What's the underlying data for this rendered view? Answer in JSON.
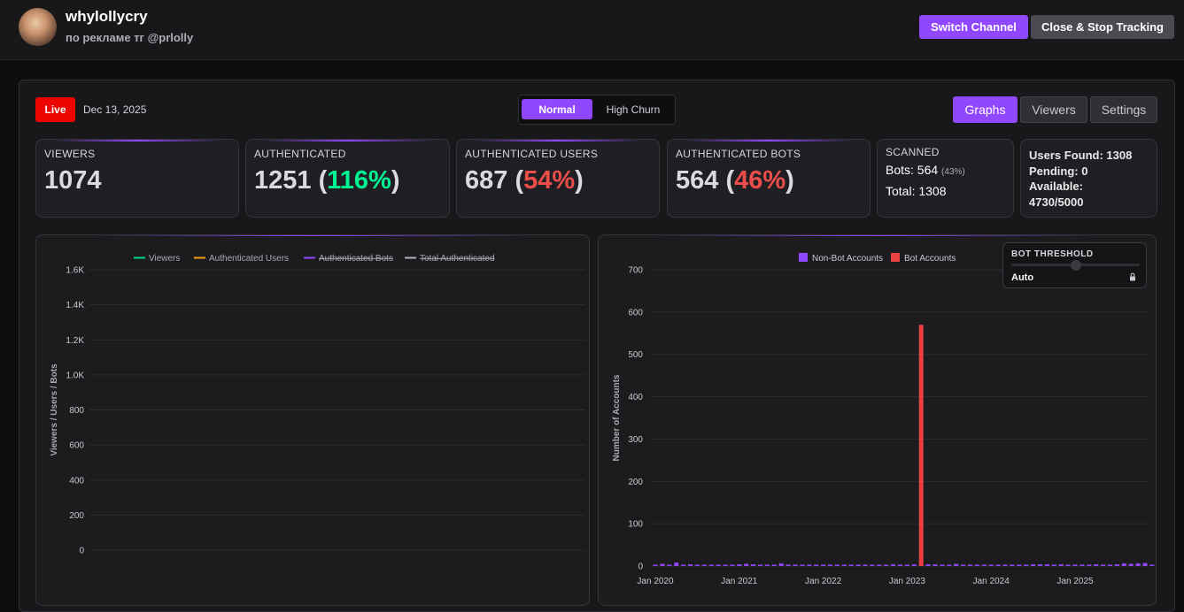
{
  "header": {
    "channel_name": "whylollycry",
    "channel_desc": "по рекламе тг @prlolly",
    "switch_label": "Switch Channel",
    "close_label": "Close & Stop Tracking"
  },
  "toolbar": {
    "live_label": "Live",
    "date": "Dec 13, 2025",
    "modes": {
      "normal": "Normal",
      "high": "High Churn",
      "selected": "Normal"
    },
    "tabs": {
      "graphs": "Graphs",
      "viewers": "Viewers",
      "settings": "Settings",
      "selected": "Graphs"
    }
  },
  "stats": {
    "viewers": {
      "label": "VIEWERS",
      "value": "1074"
    },
    "authenticated": {
      "label": "AUTHENTICATED",
      "value": "1251",
      "pct": "116%"
    },
    "auth_users": {
      "label": "AUTHENTICATED USERS",
      "value": "687",
      "pct": "54%"
    },
    "auth_bots": {
      "label": "AUTHENTICATED BOTS",
      "value": "564",
      "pct": "46%"
    },
    "scanned": {
      "label": "SCANNED",
      "bots_label": "Bots:",
      "bots": "564",
      "bots_pct": "(43%)",
      "total_label": "Total:",
      "total": "1308"
    },
    "info": {
      "users_found": "Users Found: 1308",
      "pending": "Pending: 0",
      "available_label": "Available:",
      "available": "4730/5000"
    }
  },
  "colors": {
    "accent": "#9147ff",
    "live": "#eb0400",
    "green": "#00f593",
    "red": "#eb4d4b",
    "viewers": "#00d68f",
    "auth_users": "#f59e0b",
    "auth_bots": "#9147ff",
    "total_auth": "#adadb8",
    "bot_accounts": "#eb4042"
  },
  "threshold": {
    "title": "BOT THRESHOLD",
    "value": "Auto",
    "level": 0.5
  },
  "chart_data": [
    {
      "type": "line",
      "ylabel": "Viewers / Users / Bots",
      "ylim": [
        0,
        1600
      ],
      "yticks": [
        "0",
        "200",
        "400",
        "600",
        "800",
        "1.0K",
        "1.2K",
        "1.4K",
        "1.6K"
      ],
      "legend_placement": "top",
      "series": [
        {
          "name": "Viewers",
          "color": "#00d68f",
          "hidden": false,
          "values": []
        },
        {
          "name": "Authenticated Users",
          "color": "#f59e0b",
          "hidden": false,
          "values": []
        },
        {
          "name": "Authenticated Bots",
          "color": "#9147ff",
          "hidden": true,
          "values": []
        },
        {
          "name": "Total Authenticated",
          "color": "#adadb8",
          "hidden": true,
          "values": []
        }
      ],
      "grid": true
    },
    {
      "type": "bar",
      "ylabel": "Number of Accounts",
      "ylim": [
        0,
        700
      ],
      "yticks": [
        "0",
        "100",
        "200",
        "300",
        "400",
        "500",
        "600",
        "700"
      ],
      "xticks": [
        "Jan 2020",
        "Jan 2021",
        "Jan 2022",
        "Jan 2023",
        "Jan 2024",
        "Jan 2025"
      ],
      "x_start": "2020-01",
      "x_end": "2025-12",
      "legend_placement": "top",
      "grid": true,
      "series": [
        {
          "name": "Non-Bot Accounts",
          "color": "#9147ff",
          "values": [
            {
              "x": "2020-01",
              "y": 2
            },
            {
              "x": "2020-02",
              "y": 5
            },
            {
              "x": "2020-03",
              "y": 3
            },
            {
              "x": "2020-04",
              "y": 8
            },
            {
              "x": "2020-05",
              "y": 2
            },
            {
              "x": "2020-06",
              "y": 4
            },
            {
              "x": "2020-07",
              "y": 3
            },
            {
              "x": "2020-08",
              "y": 3
            },
            {
              "x": "2020-09",
              "y": 3
            },
            {
              "x": "2020-10",
              "y": 2
            },
            {
              "x": "2020-11",
              "y": 1
            },
            {
              "x": "2020-12",
              "y": 2
            },
            {
              "x": "2021-01",
              "y": 4
            },
            {
              "x": "2021-02",
              "y": 5
            },
            {
              "x": "2021-03",
              "y": 4
            },
            {
              "x": "2021-04",
              "y": 1
            },
            {
              "x": "2021-05",
              "y": 3
            },
            {
              "x": "2021-06",
              "y": 3
            },
            {
              "x": "2021-07",
              "y": 6
            },
            {
              "x": "2021-08",
              "y": 2
            },
            {
              "x": "2021-09",
              "y": 2
            },
            {
              "x": "2021-10",
              "y": 2
            },
            {
              "x": "2021-11",
              "y": 3
            },
            {
              "x": "2021-12",
              "y": 2
            },
            {
              "x": "2022-01",
              "y": 3
            },
            {
              "x": "2022-02",
              "y": 3
            },
            {
              "x": "2022-03",
              "y": 2
            },
            {
              "x": "2022-04",
              "y": 2
            },
            {
              "x": "2022-05",
              "y": 2
            },
            {
              "x": "2022-06",
              "y": 1
            },
            {
              "x": "2022-07",
              "y": 2
            },
            {
              "x": "2022-08",
              "y": 3
            },
            {
              "x": "2022-09",
              "y": 2
            },
            {
              "x": "2022-10",
              "y": 2
            },
            {
              "x": "2022-11",
              "y": 4
            },
            {
              "x": "2022-12",
              "y": 2
            },
            {
              "x": "2023-01",
              "y": 3
            },
            {
              "x": "2023-02",
              "y": 4
            },
            {
              "x": "2023-03",
              "y": 3
            },
            {
              "x": "2023-04",
              "y": 4
            },
            {
              "x": "2023-05",
              "y": 4
            },
            {
              "x": "2023-06",
              "y": 2
            },
            {
              "x": "2023-07",
              "y": 2
            },
            {
              "x": "2023-08",
              "y": 5
            },
            {
              "x": "2023-09",
              "y": 2
            },
            {
              "x": "2023-10",
              "y": 2
            },
            {
              "x": "2023-11",
              "y": 1
            },
            {
              "x": "2023-12",
              "y": 2
            },
            {
              "x": "2024-01",
              "y": 3
            },
            {
              "x": "2024-02",
              "y": 2
            },
            {
              "x": "2024-03",
              "y": 1
            },
            {
              "x": "2024-04",
              "y": 2
            },
            {
              "x": "2024-05",
              "y": 2
            },
            {
              "x": "2024-06",
              "y": 2
            },
            {
              "x": "2024-07",
              "y": 4
            },
            {
              "x": "2024-08",
              "y": 4
            },
            {
              "x": "2024-09",
              "y": 4
            },
            {
              "x": "2024-10",
              "y": 3
            },
            {
              "x": "2024-11",
              "y": 4
            },
            {
              "x": "2024-12",
              "y": 3
            },
            {
              "x": "2025-01",
              "y": 3
            },
            {
              "x": "2025-02",
              "y": 2
            },
            {
              "x": "2025-03",
              "y": 3
            },
            {
              "x": "2025-04",
              "y": 4
            },
            {
              "x": "2025-05",
              "y": 3
            },
            {
              "x": "2025-06",
              "y": 3
            },
            {
              "x": "2025-07",
              "y": 4
            },
            {
              "x": "2025-08",
              "y": 6
            },
            {
              "x": "2025-09",
              "y": 5
            },
            {
              "x": "2025-10",
              "y": 6
            },
            {
              "x": "2025-11",
              "y": 7
            },
            {
              "x": "2025-12",
              "y": 3
            }
          ]
        },
        {
          "name": "Bot Accounts",
          "color": "#eb4042",
          "values": [
            {
              "x": "2023-03",
              "y": 570
            }
          ]
        }
      ]
    }
  ]
}
